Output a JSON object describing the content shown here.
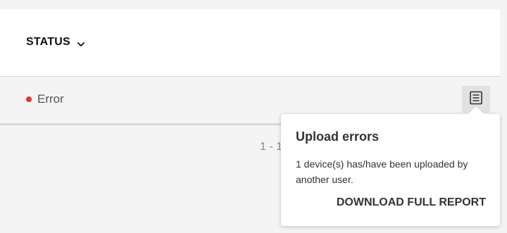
{
  "table": {
    "columns": [
      {
        "label": "STATUS",
        "sortable_icon": "chevron-down-icon"
      }
    ],
    "rows": [
      {
        "status": "Error",
        "status_color": "#e8322e",
        "action_icon": "report-icon"
      }
    ]
  },
  "pagination": {
    "text": "1 - 1"
  },
  "popover": {
    "title": "Upload errors",
    "message": "1 device(s) has/have been uploaded by another user.",
    "action_label": "DOWNLOAD FULL REPORT"
  }
}
